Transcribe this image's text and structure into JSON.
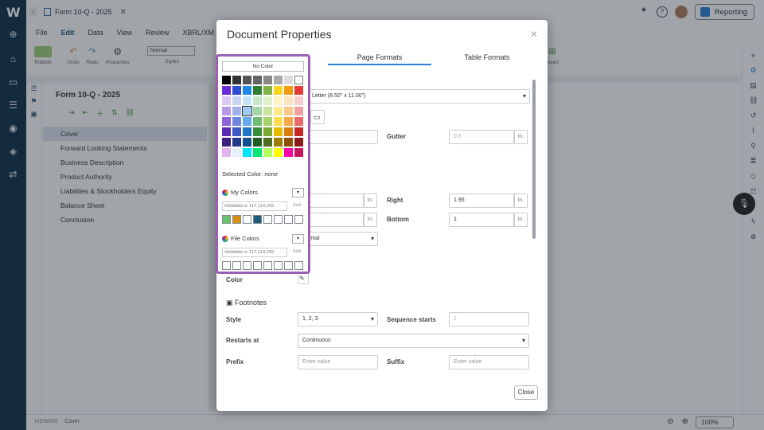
{
  "app": {
    "logo": "W"
  },
  "tab": {
    "title": "Form 10-Q - 2025",
    "close": "✕"
  },
  "header": {
    "reporting_label": "Reporting",
    "help": "?"
  },
  "menu": [
    "File",
    "Edit",
    "Data",
    "View",
    "Review",
    "XBRL/XM"
  ],
  "ribbon": {
    "publish": "Publish",
    "undo": "Undo",
    "redo": "Redo",
    "properties": "Properties",
    "style_value": "Normal",
    "styles": "Styles",
    "insert": "Insert"
  },
  "outline": {
    "title": "Form 10-Q - 2025",
    "items": [
      "Cover",
      "Forward Looking Statements",
      "Business Description",
      "Product Authority",
      "Liabilities & Stockholders Equity",
      "Balance Sheet",
      "Conclusion"
    ]
  },
  "status": {
    "viewing": "VIEWING",
    "section": "Cover",
    "zoom": "100%"
  },
  "modal": {
    "title": "Document Properties",
    "tabs": [
      "Page Formats",
      "Table Formats"
    ],
    "page_size": "Letter (8.50\" x 11.00\")",
    "gutter_label": "Gutter",
    "gutter_value": "0.5",
    "unit": "in.",
    "right_label": "Right",
    "right_value": "1.95",
    "bottom_label": "Bottom",
    "bottom_value": "1",
    "style_partial": "rmal",
    "color_label": "Color",
    "footnotes_label": "Footnotes",
    "style_label": "Style",
    "style_value": "1, 2, 3",
    "sequence_label": "Sequence starts",
    "sequence_value": "1",
    "restarts_label": "Restarts at",
    "restarts_value": "Continuous",
    "prefix_label": "Prefix",
    "prefix_placeholder": "Enter value",
    "suffix_label": "Suffix",
    "suffix_placeholder": "Enter value",
    "close_label": "Close"
  },
  "picker": {
    "no_color": "No Color",
    "selected_label": "Selected Color:",
    "selected_value": "none",
    "my_colors": "My Colors",
    "file_colors": "File Colors",
    "input_placeholder": "#dddddd or 117,114,255",
    "add": "Add",
    "dropdown": "▾",
    "palette": [
      [
        "#000000",
        "#333333",
        "#555555",
        "#666666",
        "#888888",
        "#aaaaaa",
        "#dddddd",
        "#ffffff"
      ],
      [
        "#6a2bd9",
        "#2c4fd6",
        "#1e88e5",
        "#2e7d32",
        "#7cb342",
        "#f9d423",
        "#f39c12",
        "#e53935"
      ],
      [
        "#d9c9f0",
        "#c9d3f2",
        "#c5e1f7",
        "#c8e6c9",
        "#e0f0c8",
        "#fff4c2",
        "#fde2c0",
        "#f8cdcd"
      ],
      [
        "#b89ae6",
        "#9fb0ea",
        "#9fccf2",
        "#a3d6a5",
        "#c8e39f",
        "#ffe98c",
        "#fbc98a",
        "#f19e9e"
      ],
      [
        "#8f63d6",
        "#6e86e0",
        "#64a9ea",
        "#6fbd73",
        "#a8d36a",
        "#ffdc4f",
        "#f7a94a",
        "#e96b6b"
      ],
      [
        "#5b2ab3",
        "#3c59c4",
        "#1f74c7",
        "#388e3c",
        "#7ea92f",
        "#e6b800",
        "#d97c0f",
        "#c62828"
      ],
      [
        "#3c1d80",
        "#25398a",
        "#144f8c",
        "#1f5e22",
        "#4f6e1e",
        "#9e7d00",
        "#8f520a",
        "#8c1c1c"
      ],
      [
        "#e0b3f0",
        "#e5f0f7",
        "#00e5ff",
        "#00e676",
        "#b2ff59",
        "#ffff00",
        "#ff00aa",
        "#c2185b"
      ]
    ],
    "my_swatches": [
      "#6cc36c",
      "#d4900e",
      "#ffffff",
      "#1f5b7a",
      "#ffffff",
      "#ffffff",
      "#ffffff",
      "#ffffff"
    ],
    "file_swatches": [
      "#ffffff",
      "#ffffff",
      "#ffffff",
      "#ffffff",
      "#ffffff",
      "#ffffff",
      "#ffffff",
      "#ffffff"
    ],
    "accent": "#9b5fb5"
  }
}
